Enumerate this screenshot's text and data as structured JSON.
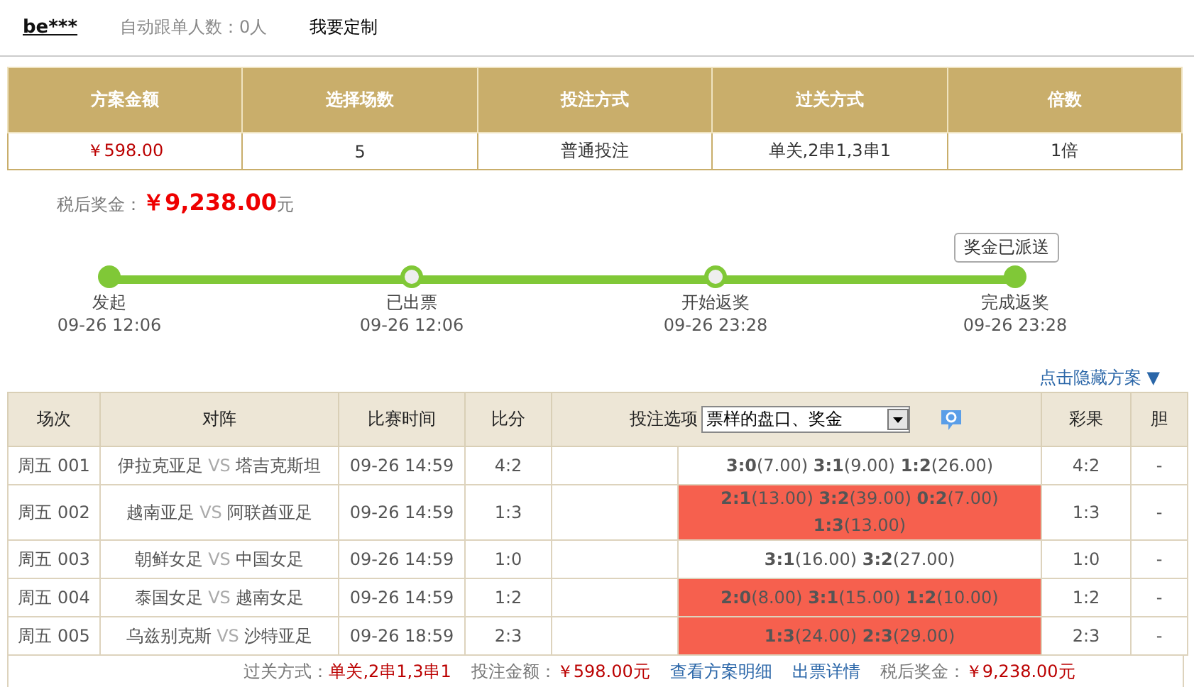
{
  "user": {
    "name": "be***",
    "follow_label": "自动跟单人数：0人",
    "custom_link": "我要定制"
  },
  "summary": {
    "columns": [
      "方案金额",
      "选择场数",
      "投注方式",
      "过关方式",
      "倍数"
    ],
    "values": [
      "￥598.00",
      "5",
      "普通投注",
      "单关,2串1,3串1",
      "1倍"
    ]
  },
  "prize": {
    "label": "税后奖金：",
    "amount": "￥9,238.00",
    "unit": "元"
  },
  "progress": {
    "badge": "奖金已派送",
    "steps": [
      {
        "label": "发起",
        "time": "09-26 12:06",
        "filled": true
      },
      {
        "label": "已出票",
        "time": "09-26 12:06",
        "filled": false
      },
      {
        "label": "开始返奖",
        "time": "09-26 23:28",
        "filled": false
      },
      {
        "label": "完成返奖",
        "time": "09-26 23:28",
        "filled": true
      }
    ]
  },
  "hide_link": "点击隐藏方案 ▼",
  "matches": {
    "columns": [
      "场次",
      "对阵",
      "比赛时间",
      "比分",
      "投注选项",
      "彩果",
      "胆"
    ],
    "option_select": {
      "value": "票样的盘口、奖金"
    },
    "rows": [
      {
        "no": "周五 001",
        "home": "伊拉克亚足",
        "vs": "VS",
        "away": "塔吉克斯坦",
        "time": "09-26 14:59",
        "score": "4:2",
        "hit": false,
        "picks": [
          {
            "pick": "3:0",
            "odds": "(7.00)"
          },
          {
            "pick": "3:1",
            "odds": "(9.00)"
          },
          {
            "pick": "1:2",
            "odds": "(26.00)"
          }
        ],
        "result": "4:2",
        "banker": "-"
      },
      {
        "no": "周五 002",
        "home": "越南亚足",
        "vs": "VS",
        "away": "阿联酋亚足",
        "time": "09-26 14:59",
        "score": "1:3",
        "hit": true,
        "picks": [
          {
            "pick": "2:1",
            "odds": "(13.00)"
          },
          {
            "pick": "3:2",
            "odds": "(39.00)"
          },
          {
            "pick": "0:2",
            "odds": "(7.00)"
          },
          {
            "pick": "1:3",
            "odds": "(13.00)"
          }
        ],
        "result": "1:3",
        "banker": "-"
      },
      {
        "no": "周五 003",
        "home": "朝鲜女足",
        "vs": "VS",
        "away": "中国女足",
        "time": "09-26 14:59",
        "score": "1:0",
        "hit": false,
        "picks": [
          {
            "pick": "3:1",
            "odds": "(16.00)"
          },
          {
            "pick": "3:2",
            "odds": "(27.00)"
          }
        ],
        "result": "1:0",
        "banker": "-"
      },
      {
        "no": "周五 004",
        "home": "泰国女足",
        "vs": "VS",
        "away": "越南女足",
        "time": "09-26 14:59",
        "score": "1:2",
        "hit": true,
        "picks": [
          {
            "pick": "2:0",
            "odds": "(8.00)"
          },
          {
            "pick": "3:1",
            "odds": "(15.00)"
          },
          {
            "pick": "1:2",
            "odds": "(10.00)"
          }
        ],
        "result": "1:2",
        "banker": "-"
      },
      {
        "no": "周五 005",
        "home": "乌兹别克斯",
        "vs": "VS",
        "away": "沙特亚足",
        "time": "09-26 18:59",
        "score": "2:3",
        "hit": true,
        "picks": [
          {
            "pick": "1:3",
            "odds": "(24.00)"
          },
          {
            "pick": "2:3",
            "odds": "(29.00)"
          }
        ],
        "result": "2:3",
        "banker": "-"
      }
    ]
  },
  "footer": {
    "pass_label": "过关方式：",
    "pass_value": "单关,2串1,3串1",
    "amount_label": "投注金额：",
    "amount_value": "￥598.00元",
    "detail_link": "查看方案明细",
    "ticket_link": "出票详情",
    "prize_label": "税后奖金：",
    "prize_value": "￥9,238.00元"
  }
}
